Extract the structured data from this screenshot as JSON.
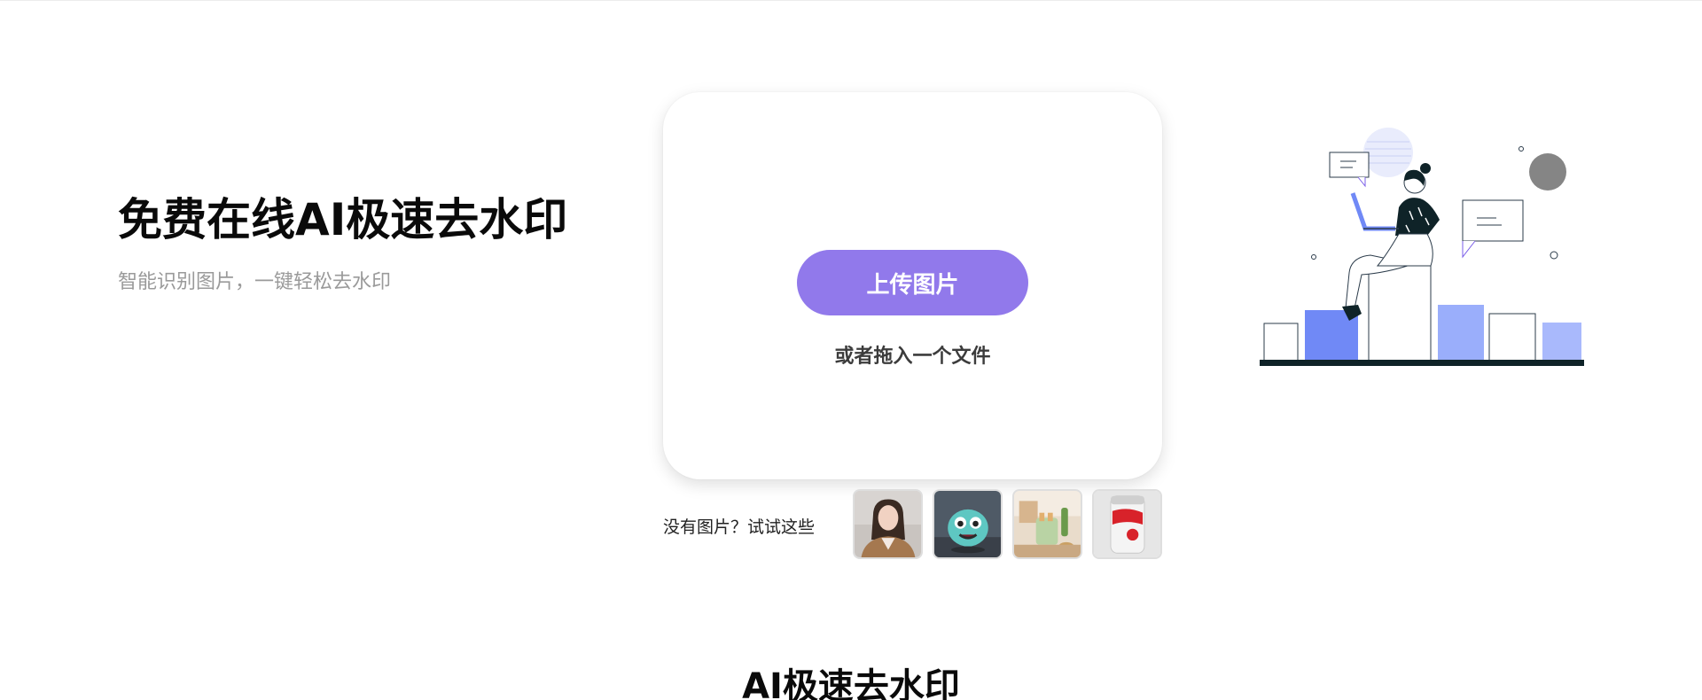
{
  "hero": {
    "title": "免费在线AI极速去水印",
    "subtitle": "智能识别图片，一键轻松去水印"
  },
  "upload": {
    "button_label": "上传图片",
    "drop_hint": "或者拖入一个文件"
  },
  "samples": {
    "label": "没有图片？试试这些",
    "items": [
      {
        "name": "portrait-woman"
      },
      {
        "name": "cartoon-monster-toy"
      },
      {
        "name": "toaster-kitchen"
      },
      {
        "name": "cola-can"
      }
    ]
  },
  "section": {
    "title": "AI极速去水印"
  },
  "colors": {
    "accent": "#9179eb",
    "illustration_blue": "#7089f6",
    "illustration_light_blue": "#9fb1fb"
  }
}
